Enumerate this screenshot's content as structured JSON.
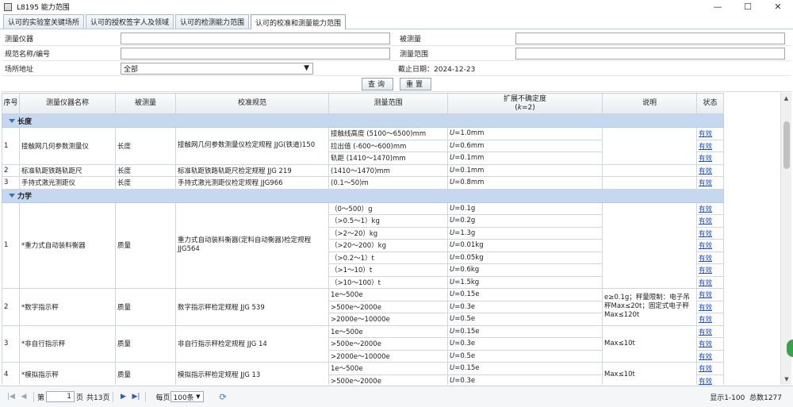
{
  "window": {
    "title": "L8195 能力范围",
    "minimize_glyph": "—",
    "maximize_glyph": "☐",
    "close_glyph": "✕"
  },
  "tabs": [
    {
      "label": "认可的实验室关键场所"
    },
    {
      "label": "认可的授权签字人及领域"
    },
    {
      "label": "认可的检测能力范围"
    },
    {
      "label": "认可的校准和测量能力范围",
      "active": true
    }
  ],
  "filter": {
    "instrument_label": "测量仪器",
    "instrument_value": "",
    "measurand_label": "被测量",
    "measurand_value": "",
    "spec_label": "规范名称/编号",
    "spec_value": "",
    "range_label": "测量范围",
    "range_value": "",
    "site_label": "场所地址",
    "site_value": "全部",
    "deadline_text": "截止日期：2024-12-23",
    "query_label": "查询",
    "reset_label": "重置"
  },
  "table": {
    "headers": {
      "seq": "序号",
      "instrument": "测量仪器名称",
      "measurand": "被测量",
      "spec": "校准规范",
      "range": "测量范围",
      "unc_line1": "扩展不确定度",
      "unc_line2_pre": "(",
      "unc_line2_k": "k",
      "unc_line2_post": "=2)",
      "note": "说明",
      "status": "状态"
    },
    "group_length": "长度",
    "group_mechanics": "力学",
    "status_valid": "有效",
    "r1": {
      "seq": "1",
      "name": "接触网几何参数测量仪",
      "measurand": "长度",
      "spec": "接触网几何参数测量仪检定规程 JJG(铁道)150",
      "ranges": [
        "接触线高度 (5100～6500)mm",
        "拉出值 (-600～600)mm",
        "轨距 (1410～1470)mm"
      ],
      "uncs": [
        "=1.0mm",
        "=0.6mm",
        "=0.1mm"
      ]
    },
    "r2": {
      "seq": "2",
      "name": "标准轨距铁路轨距尺",
      "measurand": "长度",
      "spec": "标准轨距铁路轨距尺检定规程 JJG 219",
      "range": "(1410～1470)mm",
      "unc": "=0.1mm"
    },
    "r3": {
      "seq": "3",
      "name": "手持式激光测距仪",
      "measurand": "长度",
      "spec": "手持式激光测距仪检定规程 JJG966",
      "range": "(0.1～50)m",
      "unc": "=0.8mm"
    },
    "m1": {
      "seq": "1",
      "name": "*重力式自动装料衡器",
      "measurand": "质量",
      "spec": "重力式自动装料衡器(定料自动衡器)检定规程JJG564",
      "ranges": [
        "（0～500）g",
        "（>0.5～1）kg",
        "（>2～20）kg",
        "（>20～200）kg",
        "（>0.2～1）t",
        "（>1～10）t",
        "（>10～100）t"
      ],
      "uncs": [
        "=0.1g",
        "=0.2g",
        "=1.3g",
        "=0.01kg",
        "=0.05kg",
        "=0.6kg",
        "=1.5kg"
      ]
    },
    "m2": {
      "seq": "2",
      "name": "*数字指示秤",
      "measurand": "质量",
      "spec": "数字指示秤检定规程 JJG 539",
      "ranges": [
        "1e～500e",
        ">500e～2000e",
        ">2000e～10000e"
      ],
      "uncs": [
        "=0.15e",
        "=0.3e",
        "=0.5e"
      ],
      "note": "e≥0.1g；秤量限制：电子吊秤Max≤20t；固定式电子秤Max≤120t"
    },
    "m3": {
      "seq": "3",
      "name": "*非自行指示秤",
      "measurand": "质量",
      "spec": "非自行指示秤检定规程 JJG 14",
      "ranges": [
        "1e～500e",
        ">500e～2000e",
        ">2000e～10000e"
      ],
      "uncs": [
        "=0.15e",
        "=0.3e",
        "=0.5e"
      ],
      "note": "Max≤10t"
    },
    "m4": {
      "seq": "4",
      "name": "*模拟指示秤",
      "measurand": "质量",
      "spec": "模拟指示秤检定规程 JJG 13",
      "ranges": [
        "1e～500e",
        ">500e～2000e"
      ],
      "uncs": [
        "=0.15e",
        "=0.3e"
      ],
      "note": "Max≤10t"
    },
    "unc_symbol": "U"
  },
  "pager": {
    "page_prefix": "第",
    "current_page": "1",
    "page_suffix": "页",
    "total_pages_text": "共13页",
    "per_page_label": "每页",
    "per_page_value": "100条",
    "display_range": "显示1-100",
    "total_count": "总数1277"
  }
}
